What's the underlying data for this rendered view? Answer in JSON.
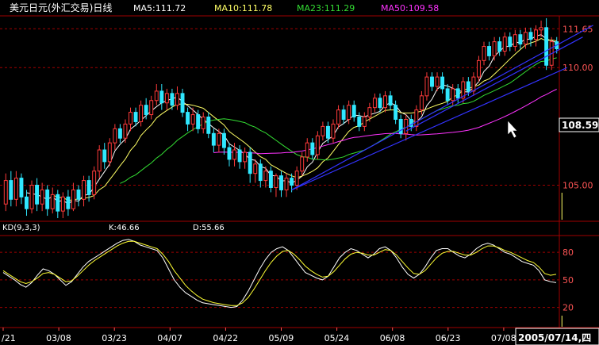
{
  "colors": {
    "background": "#000000",
    "frame": "#a00000",
    "up": "#ff3a3a",
    "down": "#30e8ff",
    "ma5": "#ffffff",
    "ma10": "#ffff66",
    "ma23": "#33dd33",
    "ma50": "#ff33ff",
    "trendline": "#3333ff",
    "k_line": "#ffffff",
    "d_line": "#ffff33",
    "text": "#ffffff",
    "axis_text": "#ff5555"
  },
  "header": {
    "title": "美元日元(外汇交易)日线",
    "ma5": "MA5:111.72",
    "ma10": "MA10:111.78",
    "ma23": "MA23:111.29",
    "ma50": "MA50:109.58"
  },
  "kd_header": {
    "name": "KD(9,3,3)",
    "k": "K:46.66",
    "d": "D:55.66"
  },
  "price_badge": "108.59",
  "date_badge": "2005/07/14,四",
  "chart_data": [
    {
      "type": "candlestick",
      "title": "美元日元(外汇交易)日线",
      "y_range": [
        103.5,
        112.2
      ],
      "y_ticks": [
        {
          "label": "111.65",
          "value": 111.65
        },
        {
          "label": "110.00",
          "value": 110.0
        },
        {
          "label": "105.00",
          "value": 105.0
        }
      ],
      "x_ticks": [
        "/21",
        "03/08",
        "03/23",
        "04/07",
        "04/22",
        "05/09",
        "05/24",
        "06/08",
        "06/23",
        "07/08"
      ],
      "x_tick_index": [
        0,
        11,
        22,
        33,
        44,
        55,
        66,
        77,
        88,
        99
      ],
      "candles": [
        [
          104.2,
          105.2,
          103.9,
          105.5
        ],
        [
          105.2,
          104.4,
          104.1,
          105.6
        ],
        [
          104.4,
          105.3,
          104.1,
          105.6
        ],
        [
          105.3,
          104.5,
          104.2,
          105.5
        ],
        [
          104.5,
          104.0,
          103.7,
          104.8
        ],
        [
          104.0,
          105.0,
          103.8,
          105.2
        ],
        [
          105.0,
          104.2,
          103.9,
          105.3
        ],
        [
          104.2,
          104.8,
          103.9,
          105.1
        ],
        [
          104.8,
          104.0,
          103.7,
          105.0
        ],
        [
          104.0,
          104.6,
          103.8,
          104.9
        ],
        [
          104.6,
          103.9,
          103.6,
          104.8
        ],
        [
          103.9,
          104.5,
          103.6,
          104.7
        ],
        [
          104.5,
          104.0,
          103.7,
          104.8
        ],
        [
          104.0,
          104.8,
          103.9,
          105.1
        ],
        [
          104.8,
          104.4,
          104.1,
          105.0
        ],
        [
          104.4,
          105.2,
          104.1,
          105.4
        ],
        [
          105.2,
          104.6,
          104.3,
          105.4
        ],
        [
          104.6,
          105.6,
          104.4,
          105.8
        ],
        [
          105.6,
          106.5,
          105.3,
          106.7
        ],
        [
          106.5,
          106.0,
          105.7,
          106.8
        ],
        [
          106.0,
          106.8,
          105.8,
          107.0
        ],
        [
          106.8,
          107.4,
          106.5,
          107.6
        ],
        [
          107.4,
          107.0,
          106.8,
          107.6
        ],
        [
          107.0,
          107.6,
          106.8,
          107.8
        ],
        [
          107.6,
          108.1,
          107.3,
          108.3
        ],
        [
          108.1,
          107.7,
          107.5,
          108.3
        ],
        [
          107.7,
          108.4,
          107.5,
          108.6
        ],
        [
          108.4,
          108.0,
          107.8,
          108.7
        ],
        [
          108.0,
          108.6,
          107.8,
          108.8
        ],
        [
          108.6,
          109.0,
          108.4,
          109.3
        ],
        [
          109.0,
          108.5,
          108.2,
          109.3
        ],
        [
          108.5,
          108.9,
          108.2,
          109.1
        ],
        [
          108.9,
          108.4,
          108.2,
          109.1
        ],
        [
          108.4,
          108.9,
          108.2,
          109.2
        ],
        [
          108.9,
          108.1,
          107.9,
          109.1
        ],
        [
          108.1,
          107.6,
          107.3,
          108.3
        ],
        [
          107.6,
          108.0,
          107.3,
          108.3
        ],
        [
          108.0,
          107.4,
          107.2,
          108.2
        ],
        [
          107.4,
          107.9,
          107.2,
          108.1
        ],
        [
          107.9,
          107.2,
          107.0,
          108.1
        ],
        [
          107.2,
          106.7,
          106.4,
          107.4
        ],
        [
          106.7,
          107.2,
          106.4,
          107.4
        ],
        [
          107.2,
          106.6,
          106.3,
          107.4
        ],
        [
          106.6,
          106.1,
          105.8,
          106.8
        ],
        [
          106.1,
          106.5,
          105.8,
          106.8
        ],
        [
          106.5,
          106.0,
          105.7,
          106.7
        ],
        [
          106.0,
          106.4,
          105.7,
          106.6
        ],
        [
          106.4,
          105.5,
          105.1,
          106.6
        ],
        [
          105.5,
          105.9,
          105.1,
          106.1
        ],
        [
          105.9,
          105.2,
          104.9,
          106.1
        ],
        [
          105.2,
          105.6,
          104.9,
          105.8
        ],
        [
          105.6,
          104.9,
          104.7,
          105.8
        ],
        [
          104.9,
          105.4,
          104.5,
          105.5
        ],
        [
          105.4,
          104.8,
          104.5,
          105.6
        ],
        [
          104.8,
          105.3,
          104.5,
          105.5
        ],
        [
          105.3,
          105.0,
          104.7,
          105.5
        ],
        [
          105.0,
          105.6,
          104.8,
          105.8
        ],
        [
          105.6,
          106.2,
          105.4,
          106.4
        ],
        [
          106.2,
          106.8,
          106.0,
          107.0
        ],
        [
          106.8,
          106.3,
          106.1,
          107.0
        ],
        [
          106.3,
          107.1,
          106.1,
          107.3
        ],
        [
          107.1,
          107.5,
          106.9,
          107.7
        ],
        [
          107.5,
          107.0,
          106.8,
          107.7
        ],
        [
          107.0,
          107.6,
          106.8,
          107.8
        ],
        [
          107.6,
          108.2,
          107.4,
          108.4
        ],
        [
          108.2,
          107.8,
          107.6,
          108.4
        ],
        [
          107.8,
          108.4,
          107.6,
          108.6
        ],
        [
          108.4,
          107.9,
          107.7,
          108.6
        ],
        [
          107.9,
          107.5,
          107.3,
          108.1
        ],
        [
          107.5,
          107.9,
          107.3,
          108.1
        ],
        [
          107.9,
          108.3,
          107.7,
          108.5
        ],
        [
          108.3,
          108.7,
          108.1,
          108.9
        ],
        [
          108.7,
          108.3,
          108.1,
          108.9
        ],
        [
          108.3,
          108.8,
          108.1,
          109.0
        ],
        [
          108.8,
          108.4,
          108.2,
          109.0
        ],
        [
          108.4,
          107.8,
          107.6,
          108.6
        ],
        [
          107.8,
          107.2,
          107.0,
          108.0
        ],
        [
          107.2,
          107.8,
          106.9,
          108.0
        ],
        [
          107.8,
          107.5,
          107.3,
          108.0
        ],
        [
          107.5,
          108.2,
          107.3,
          108.4
        ],
        [
          108.2,
          108.8,
          108.0,
          109.0
        ],
        [
          108.8,
          109.6,
          108.6,
          109.8
        ],
        [
          109.6,
          109.2,
          109.0,
          109.8
        ],
        [
          109.2,
          109.6,
          109.0,
          109.8
        ],
        [
          109.6,
          109.1,
          108.9,
          109.8
        ],
        [
          109.1,
          108.6,
          108.4,
          109.3
        ],
        [
          108.6,
          109.1,
          108.4,
          109.3
        ],
        [
          109.1,
          108.7,
          108.5,
          109.3
        ],
        [
          108.7,
          109.4,
          108.5,
          109.6
        ],
        [
          109.4,
          109.0,
          108.8,
          109.6
        ],
        [
          109.0,
          109.6,
          108.8,
          109.8
        ],
        [
          109.6,
          110.3,
          109.4,
          110.5
        ],
        [
          110.3,
          110.9,
          110.1,
          111.1
        ],
        [
          110.9,
          110.5,
          110.3,
          111.1
        ],
        [
          110.5,
          111.1,
          110.3,
          111.3
        ],
        [
          111.1,
          110.7,
          110.5,
          111.3
        ],
        [
          110.7,
          111.3,
          110.5,
          111.5
        ],
        [
          111.3,
          110.9,
          110.7,
          111.5
        ],
        [
          110.9,
          111.4,
          110.7,
          111.6
        ],
        [
          111.4,
          111.0,
          110.8,
          111.6
        ],
        [
          111.0,
          111.5,
          110.8,
          111.7
        ],
        [
          111.5,
          111.2,
          110.9,
          111.7
        ],
        [
          111.2,
          111.6,
          110.9,
          111.8
        ],
        [
          111.6,
          111.7,
          111.3,
          112.0
        ],
        [
          111.7,
          110.1,
          109.9,
          112.1
        ],
        [
          110.1,
          111.1,
          109.9,
          111.3
        ],
        [
          111.1,
          110.8,
          110.6,
          111.3
        ]
      ],
      "ma": [
        {
          "name": "MA5",
          "color_key": "ma5",
          "period": 5
        },
        {
          "name": "MA10",
          "color_key": "ma10",
          "period": 10
        },
        {
          "name": "MA23",
          "color_key": "ma23",
          "period": 23
        },
        {
          "name": "MA50",
          "color_key": "ma50",
          "period": 50,
          "start_index": 40
        }
      ],
      "trendlines": [
        {
          "from": [
            55,
            104.8
          ],
          "to": [
            113,
            111.8
          ]
        },
        {
          "from": [
            55,
            104.8
          ],
          "to": [
            108,
            110.0
          ]
        },
        {
          "from": [
            77,
            107.3
          ],
          "to": [
            111,
            111.3
          ]
        }
      ],
      "volume_spike_index": 107
    },
    {
      "type": "line",
      "title": "KD(9,3,3)",
      "y_range": [
        5,
        100
      ],
      "y_ticks": [
        80,
        50,
        20
      ],
      "series": [
        {
          "name": "K",
          "color_key": "k_line",
          "values": [
            58,
            54,
            50,
            45,
            42,
            47,
            55,
            62,
            60,
            56,
            50,
            44,
            48,
            56,
            64,
            70,
            74,
            78,
            82,
            86,
            90,
            93,
            94,
            92,
            88,
            86,
            84,
            82,
            74,
            62,
            50,
            42,
            36,
            32,
            28,
            25,
            24,
            23,
            22,
            21,
            20,
            21,
            28,
            38,
            50,
            62,
            72,
            80,
            84,
            86,
            82,
            74,
            66,
            58,
            55,
            52,
            50,
            54,
            64,
            74,
            80,
            84,
            82,
            78,
            74,
            78,
            84,
            86,
            82,
            74,
            64,
            56,
            52,
            56,
            64,
            74,
            82,
            84,
            84,
            80,
            76,
            74,
            78,
            84,
            88,
            90,
            88,
            84,
            80,
            78,
            74,
            70,
            68,
            66,
            60,
            50,
            48,
            47
          ]
        },
        {
          "name": "D",
          "color_key": "d_line",
          "values": [
            60,
            56,
            52,
            48,
            46,
            48,
            52,
            57,
            58,
            56,
            52,
            48,
            49,
            54,
            60,
            66,
            71,
            75,
            79,
            83,
            87,
            90,
            92,
            92,
            90,
            88,
            86,
            84,
            78,
            70,
            60,
            52,
            44,
            38,
            33,
            29,
            27,
            25,
            24,
            23,
            22,
            22,
            25,
            31,
            40,
            50,
            60,
            69,
            76,
            81,
            82,
            78,
            72,
            65,
            60,
            56,
            53,
            54,
            59,
            66,
            73,
            78,
            80,
            79,
            77,
            77,
            80,
            83,
            82,
            77,
            70,
            63,
            57,
            56,
            60,
            67,
            74,
            79,
            81,
            81,
            79,
            77,
            77,
            80,
            84,
            87,
            87,
            85,
            82,
            80,
            77,
            74,
            71,
            69,
            64,
            57,
            55,
            56
          ]
        }
      ]
    }
  ]
}
